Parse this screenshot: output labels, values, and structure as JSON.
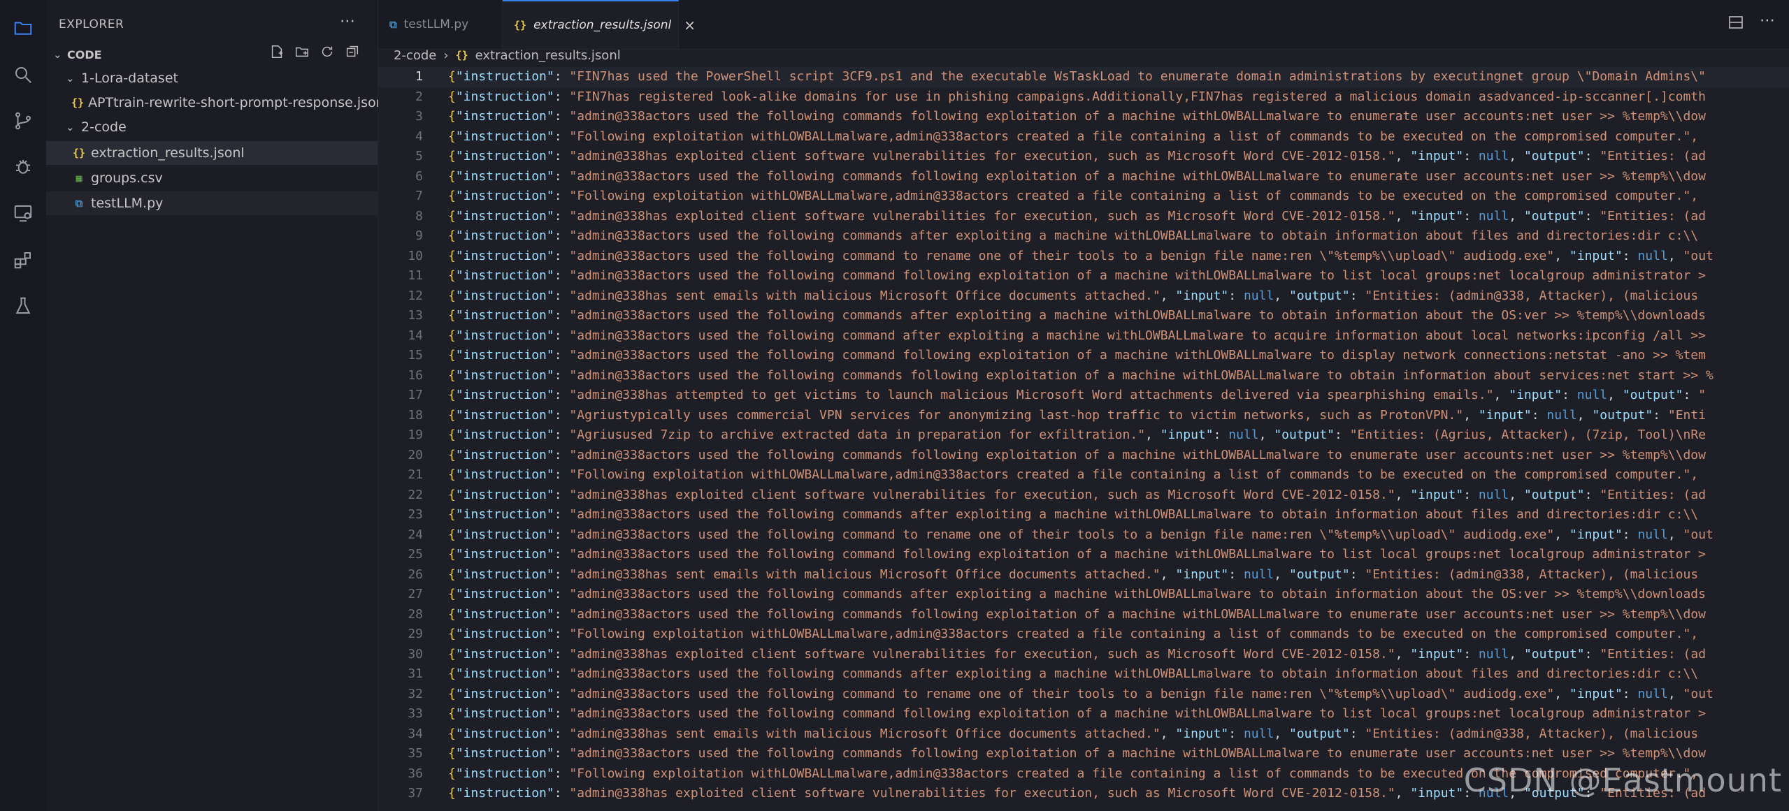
{
  "sidebar": {
    "title": "EXPLORER",
    "more": "⋯",
    "section": "CODE",
    "tree": [
      {
        "label": "1-Lora-dataset",
        "type": "folder",
        "depth": 1
      },
      {
        "label": "APTtrain-rewrite-short-prompt-response.jsonl",
        "type": "json",
        "depth": 2
      },
      {
        "label": "2-code",
        "type": "folder",
        "depth": 1
      },
      {
        "label": "extraction_results.jsonl",
        "type": "json",
        "depth": 2
      },
      {
        "label": "groups.csv",
        "type": "csv",
        "depth": 2
      },
      {
        "label": "testLLM.py",
        "type": "py",
        "depth": 2
      }
    ]
  },
  "tabs": [
    {
      "label": "testLLM.py",
      "icon": "python-icon",
      "active": false
    },
    {
      "label": "extraction_results.jsonl",
      "icon": "json-icon",
      "active": true,
      "close": "×"
    }
  ],
  "breadcrumb": {
    "folder": "2-code",
    "sep": "›",
    "file": "extraction_results.jsonl"
  },
  "editor": {
    "current_line": 1,
    "lines": [
      {
        "n": 1,
        "v": "\"FIN7has used the PowerShell script 3CF9.ps1 and the executable WsTaskLoad to enumerate domain administrations by executingnet group \\\"Domain Admins\\\"",
        "t": ""
      },
      {
        "n": 2,
        "v": "\"FIN7has registered look-alike domains for use in phishing campaigns.Additionally,FIN7has registered a malicious domain asadvanced-ip-sccanner[.]comth",
        "t": ""
      },
      {
        "n": 3,
        "v": "\"admin@338actors used the following commands following exploitation of a machine withLOWBALLmalware to enumerate user accounts:net user >> %temp%\\\\dow",
        "t": ""
      },
      {
        "n": 4,
        "v": "\"Following exploitation withLOWBALLmalware,admin@338actors created a file containing a list of commands to be executed on the compromised computer.\",",
        "t": ""
      },
      {
        "n": 5,
        "v": "\"admin@338has exploited client software vulnerabilities for execution, such as Microsoft Word CVE-2012-0158.\"",
        "t": ", \"input\": null, \"output\": \"Entities: (ad"
      },
      {
        "n": 6,
        "v": "\"admin@338actors used the following commands following exploitation of a machine withLOWBALLmalware to enumerate user accounts:net user >> %temp%\\\\dow",
        "t": ""
      },
      {
        "n": 7,
        "v": "\"Following exploitation withLOWBALLmalware,admin@338actors created a file containing a list of commands to be executed on the compromised computer.\",",
        "t": ""
      },
      {
        "n": 8,
        "v": "\"admin@338has exploited client software vulnerabilities for execution, such as Microsoft Word CVE-2012-0158.\"",
        "t": ", \"input\": null, \"output\": \"Entities: (ad"
      },
      {
        "n": 9,
        "v": "\"admin@338actors used the following commands after exploiting a machine withLOWBALLmalware to obtain information about files and directories:dir c:\\\\",
        "t": ""
      },
      {
        "n": 10,
        "v": "\"admin@338actors used the following command to rename one of their tools to a benign file name:ren \\\"%temp%\\\\upload\\\" audiodg.exe\"",
        "t": ", \"input\": null, \"out"
      },
      {
        "n": 11,
        "v": "\"admin@338actors used the following command following exploitation of a machine withLOWBALLmalware to list local groups:net localgroup administrator >",
        "t": ""
      },
      {
        "n": 12,
        "v": "\"admin@338has sent emails with malicious Microsoft Office documents attached.\"",
        "t": ", \"input\": null, \"output\": \"Entities: (admin@338, Attacker), (malicious"
      },
      {
        "n": 13,
        "v": "\"admin@338actors used the following commands after exploiting a machine withLOWBALLmalware to obtain information about the OS:ver >> %temp%\\\\downloads",
        "t": ""
      },
      {
        "n": 14,
        "v": "\"admin@338actors used the following command after exploiting a machine withLOWBALLmalware to acquire information about local networks:ipconfig /all >>",
        "t": ""
      },
      {
        "n": 15,
        "v": "\"admin@338actors used the following command following exploitation of a machine withLOWBALLmalware to display network connections:netstat -ano >> %tem",
        "t": ""
      },
      {
        "n": 16,
        "v": "\"admin@338actors used the following commands following exploitation of a machine withLOWBALLmalware to obtain information about services:net start >> %",
        "t": ""
      },
      {
        "n": 17,
        "v": "\"admin@338has attempted to get victims to launch malicious Microsoft Word attachments delivered via spearphishing emails.\"",
        "t": ", \"input\": null, \"output\": \""
      },
      {
        "n": 18,
        "v": "\"Agriustypically uses commercial VPN services for anonymizing last-hop traffic to victim networks, such as ProtonVPN.\"",
        "t": ", \"input\": null, \"output\": \"Enti"
      },
      {
        "n": 19,
        "v": "\"Agriusused 7zip to archive extracted data in preparation for exfiltration.\"",
        "t": ", \"input\": null, \"output\": \"Entities: (Agrius, Attacker), (7zip, Tool)\\nRe"
      },
      {
        "n": 20,
        "v": "\"admin@338actors used the following commands following exploitation of a machine withLOWBALLmalware to enumerate user accounts:net user >> %temp%\\\\dow",
        "t": ""
      },
      {
        "n": 21,
        "v": "\"Following exploitation withLOWBALLmalware,admin@338actors created a file containing a list of commands to be executed on the compromised computer.\",",
        "t": ""
      },
      {
        "n": 22,
        "v": "\"admin@338has exploited client software vulnerabilities for execution, such as Microsoft Word CVE-2012-0158.\"",
        "t": ", \"input\": null, \"output\": \"Entities: (ad"
      },
      {
        "n": 23,
        "v": "\"admin@338actors used the following commands after exploiting a machine withLOWBALLmalware to obtain information about files and directories:dir c:\\\\",
        "t": ""
      },
      {
        "n": 24,
        "v": "\"admin@338actors used the following command to rename one of their tools to a benign file name:ren \\\"%temp%\\\\upload\\\" audiodg.exe\"",
        "t": ", \"input\": null, \"out"
      },
      {
        "n": 25,
        "v": "\"admin@338actors used the following command following exploitation of a machine withLOWBALLmalware to list local groups:net localgroup administrator >",
        "t": ""
      },
      {
        "n": 26,
        "v": "\"admin@338has sent emails with malicious Microsoft Office documents attached.\"",
        "t": ", \"input\": null, \"output\": \"Entities: (admin@338, Attacker), (malicious"
      },
      {
        "n": 27,
        "v": "\"admin@338actors used the following commands after exploiting a machine withLOWBALLmalware to obtain information about the OS:ver >> %temp%\\\\downloads",
        "t": ""
      },
      {
        "n": 28,
        "v": "\"admin@338actors used the following commands following exploitation of a machine withLOWBALLmalware to enumerate user accounts:net user >> %temp%\\\\dow",
        "t": ""
      },
      {
        "n": 29,
        "v": "\"Following exploitation withLOWBALLmalware,admin@338actors created a file containing a list of commands to be executed on the compromised computer.\",",
        "t": ""
      },
      {
        "n": 30,
        "v": "\"admin@338has exploited client software vulnerabilities for execution, such as Microsoft Word CVE-2012-0158.\"",
        "t": ", \"input\": null, \"output\": \"Entities: (ad"
      },
      {
        "n": 31,
        "v": "\"admin@338actors used the following commands after exploiting a machine withLOWBALLmalware to obtain information about files and directories:dir c:\\\\",
        "t": ""
      },
      {
        "n": 32,
        "v": "\"admin@338actors used the following command to rename one of their tools to a benign file name:ren \\\"%temp%\\\\upload\\\" audiodg.exe\"",
        "t": ", \"input\": null, \"out"
      },
      {
        "n": 33,
        "v": "\"admin@338actors used the following command following exploitation of a machine withLOWBALLmalware to list local groups:net localgroup administrator >",
        "t": ""
      },
      {
        "n": 34,
        "v": "\"admin@338has sent emails with malicious Microsoft Office documents attached.\"",
        "t": ", \"input\": null, \"output\": \"Entities: (admin@338, Attacker), (malicious"
      },
      {
        "n": 35,
        "v": "\"admin@338actors used the following commands following exploitation of a machine withLOWBALLmalware to enumerate user accounts:net user >> %temp%\\\\dow",
        "t": ""
      },
      {
        "n": 36,
        "v": "\"Following exploitation withLOWBALLmalware,admin@338actors created a file containing a list of commands to be executed on the compromised computer.\",",
        "t": ""
      },
      {
        "n": 37,
        "v": "\"admin@338has exploited client software vulnerabilities for execution, such as Microsoft Word CVE-2012-0158.\"",
        "t": ", \"input\": null, \"output\": \"Entities: (ad"
      }
    ]
  },
  "watermark": "CSDN @Eastmount",
  "colors": {
    "accent": "#3b82f6",
    "key": "#9cdcfe",
    "string": "#ce9178",
    "null": "#569cd6"
  }
}
